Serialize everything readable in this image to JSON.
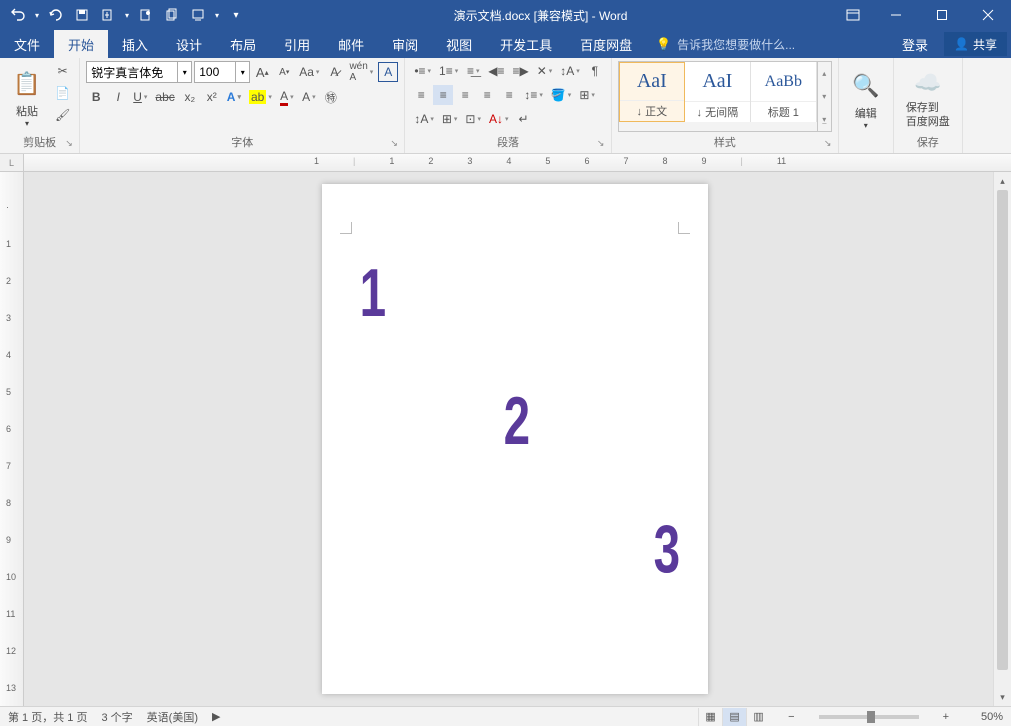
{
  "title": "演示文档.docx [兼容模式] - Word",
  "qat": {
    "undo": "↶",
    "redo": "↻",
    "save": "💾",
    "more": "▾"
  },
  "tabs": {
    "file": "文件",
    "home": "开始",
    "insert": "插入",
    "design": "设计",
    "layout": "布局",
    "references": "引用",
    "mailings": "邮件",
    "review": "审阅",
    "view": "视图",
    "developer": "开发工具",
    "baidu": "百度网盘"
  },
  "tellme": "告诉我您想要做什么...",
  "login": "登录",
  "share": "共享",
  "ribbon": {
    "clipboard": {
      "label": "剪贴板",
      "paste": "粘贴"
    },
    "font": {
      "label": "字体",
      "name": "锐字真言体免",
      "size": "100"
    },
    "paragraph": {
      "label": "段落"
    },
    "styles": {
      "label": "样式",
      "items": [
        {
          "preview": "AaI",
          "name": "↓ 正文"
        },
        {
          "preview": "AaI",
          "name": "↓ 无间隔"
        },
        {
          "preview": "AaBb",
          "name": "标题 1"
        }
      ]
    },
    "editing": {
      "label": "编辑"
    },
    "save": {
      "label": "保存",
      "btn": "保存到\n百度网盘"
    }
  },
  "ruler_corner": "L",
  "document": {
    "numbers": [
      "1",
      "2",
      "3"
    ]
  },
  "status": {
    "page": "第 1 页，共 1 页",
    "words": "3 个字",
    "lang": "英语(美国)",
    "zoom": "50%"
  }
}
